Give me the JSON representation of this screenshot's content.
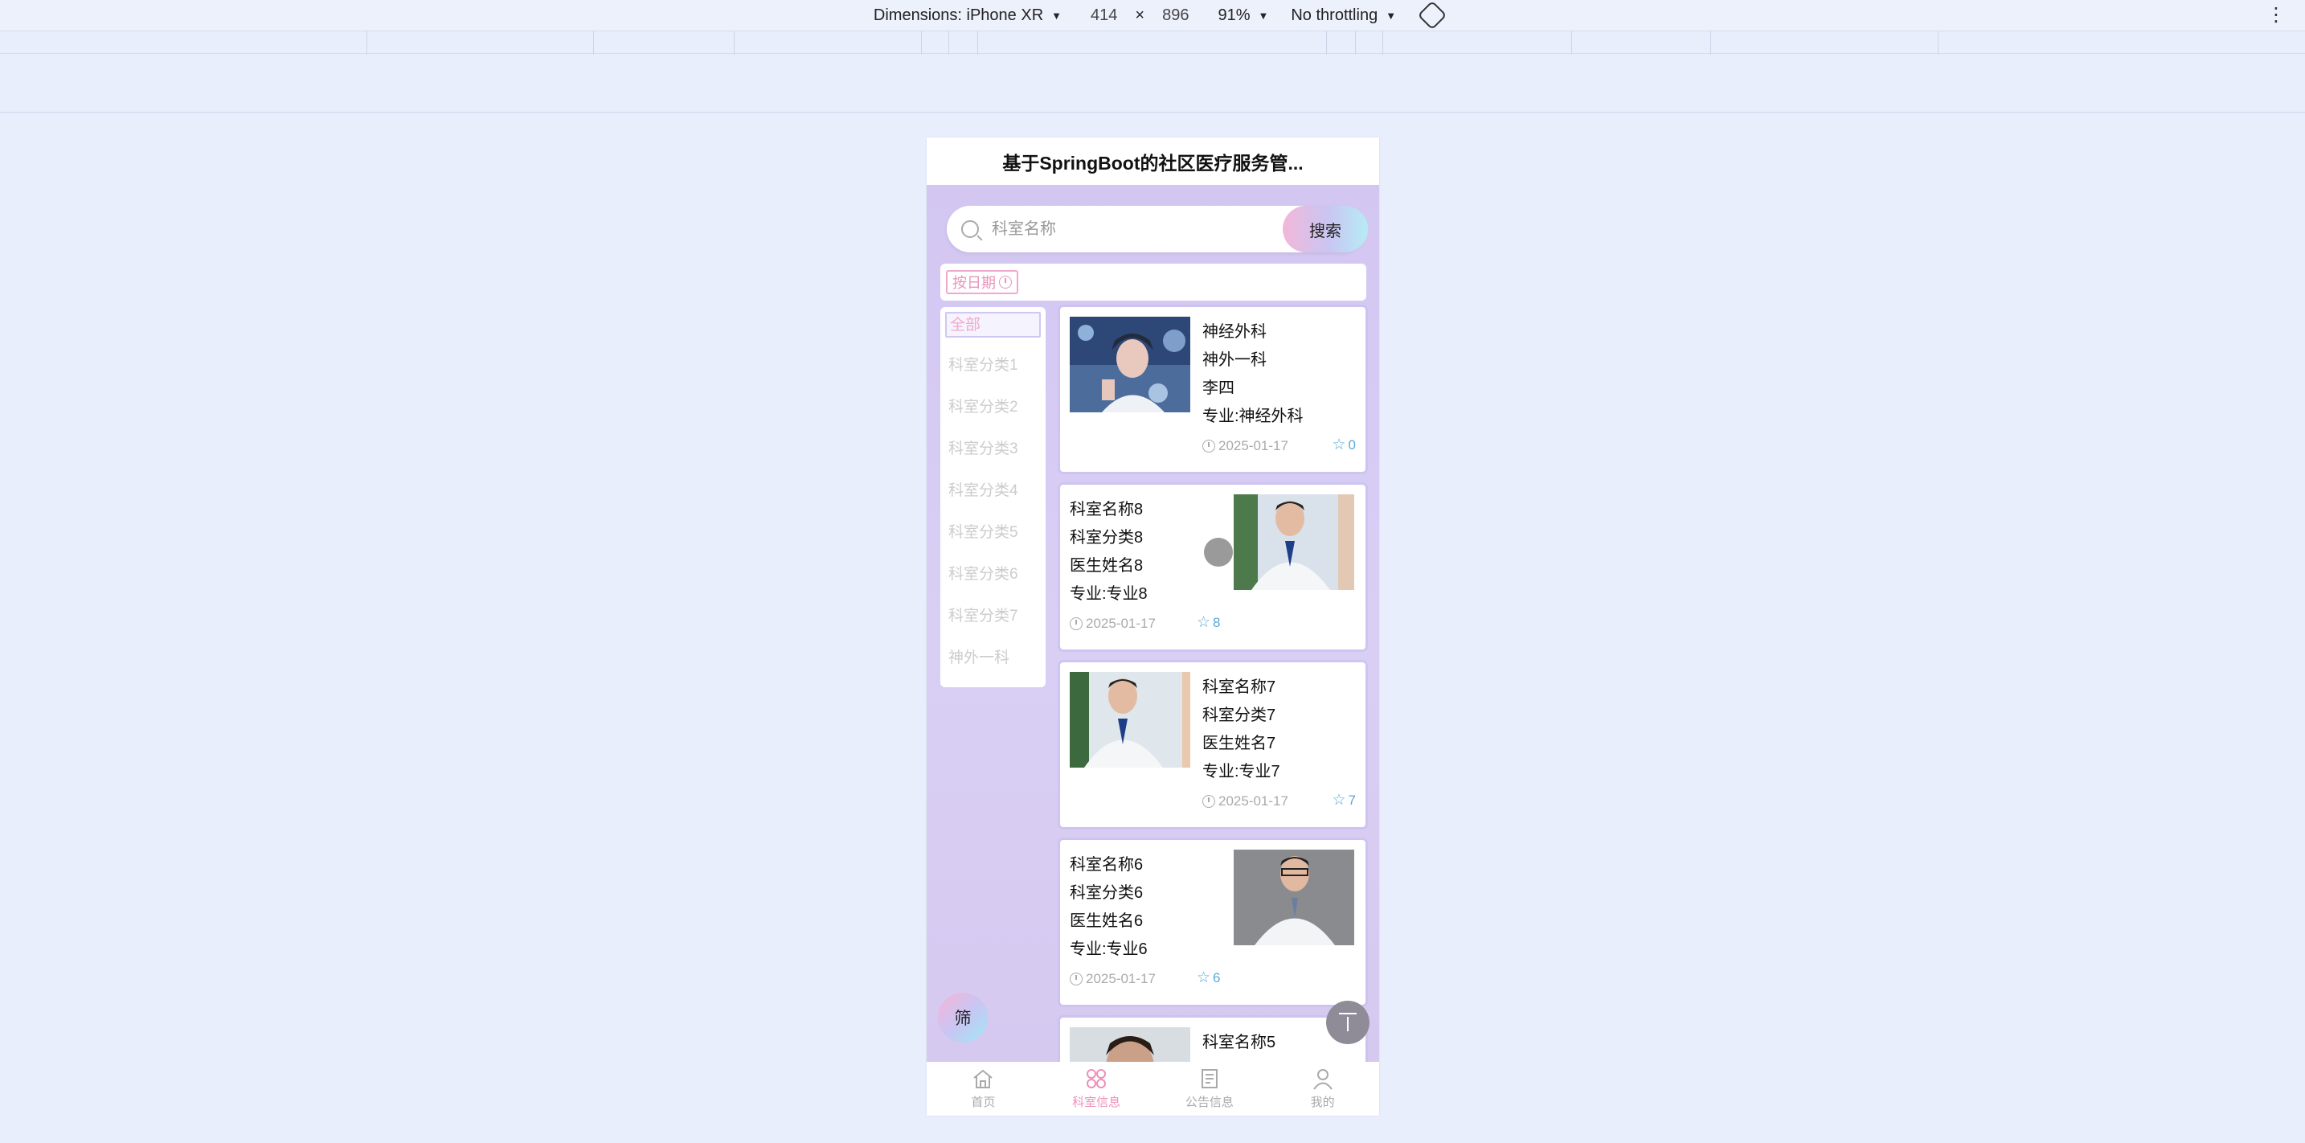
{
  "devtools": {
    "dimensions_label": "Dimensions: iPhone XR",
    "width": "414",
    "times": "×",
    "height": "896",
    "zoom": "91%",
    "throttling": "No throttling"
  },
  "header": {
    "title": "基于SpringBoot的社区医疗服务管..."
  },
  "search": {
    "placeholder": "科室名称",
    "button_label": "搜索"
  },
  "sort": {
    "date_label": "按日期"
  },
  "categories": [
    {
      "label": "全部"
    },
    {
      "label": "科室分类1"
    },
    {
      "label": "科室分类2"
    },
    {
      "label": "科室分类3"
    },
    {
      "label": "科室分类4"
    },
    {
      "label": "科室分类5"
    },
    {
      "label": "科室分类6"
    },
    {
      "label": "科室分类7"
    },
    {
      "label": "神外一科"
    }
  ],
  "cards": [
    {
      "name": "神经外科",
      "category": "神外一科",
      "doctor": "李四",
      "specialty": "专业:神经外科",
      "date": "2025-01-17",
      "likes": "0"
    },
    {
      "name": "科室名称8",
      "category": "科室分类8",
      "doctor": "医生姓名8",
      "specialty": "专业:专业8",
      "date": "2025-01-17",
      "likes": "8"
    },
    {
      "name": "科室名称7",
      "category": "科室分类7",
      "doctor": "医生姓名7",
      "specialty": "专业:专业7",
      "date": "2025-01-17",
      "likes": "7"
    },
    {
      "name": "科室名称6",
      "category": "科室分类6",
      "doctor": "医生姓名6",
      "specialty": "专业:专业6",
      "date": "2025-01-17",
      "likes": "6"
    },
    {
      "name": "科室名称5"
    }
  ],
  "filter_label": "筛",
  "tabbar": [
    {
      "label": "首页",
      "icon": "home-icon"
    },
    {
      "label": "科室信息",
      "icon": "grid-icon"
    },
    {
      "label": "公告信息",
      "icon": "news-icon"
    },
    {
      "label": "我的",
      "icon": "user-icon"
    }
  ],
  "colors": {
    "accent": "#ef8fb7",
    "likes": "#5aa9d6"
  }
}
